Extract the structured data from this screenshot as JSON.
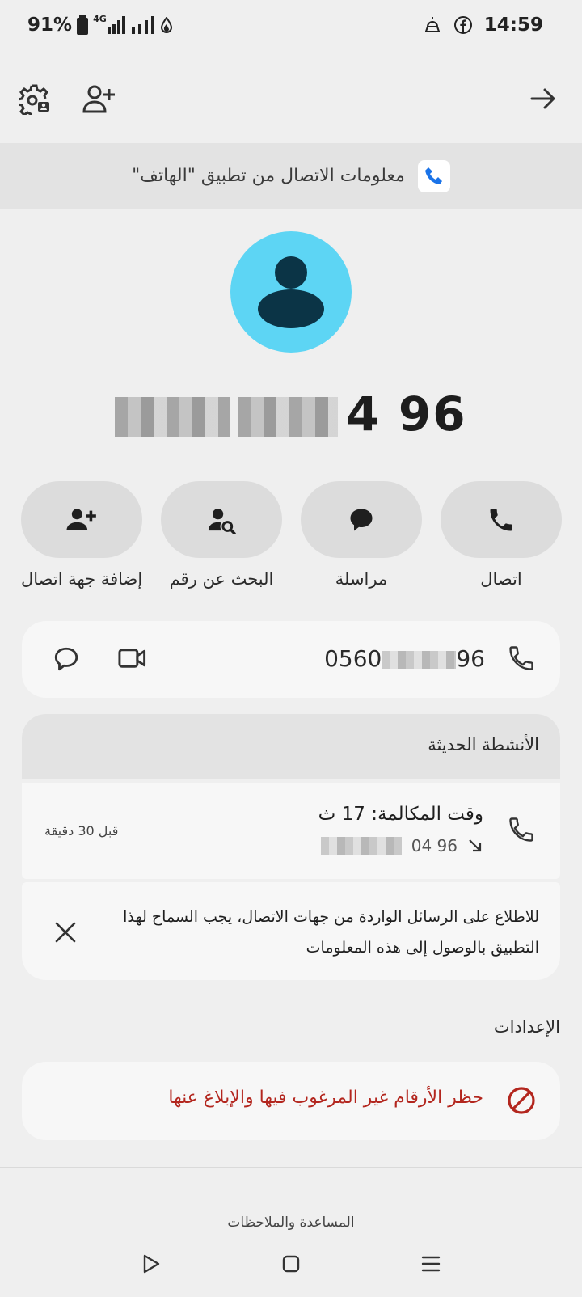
{
  "status_bar": {
    "battery": "91%",
    "network": "4G",
    "time": "14:59"
  },
  "banner": {
    "text": "معلومات الاتصال من تطبيق \"الهاتف\""
  },
  "contact": {
    "number_visible_tail": "4 96",
    "phone_prefix": "0560",
    "phone_suffix": "96"
  },
  "actions": [
    {
      "label": "اتصال",
      "icon": "phone-icon"
    },
    {
      "label": "مراسلة",
      "icon": "message-icon"
    },
    {
      "label": "البحث عن رقم",
      "icon": "person-search-icon"
    },
    {
      "label": "إضافة جهة اتصال",
      "icon": "person-add-icon"
    }
  ],
  "recent": {
    "title": "الأنشطة الحديثة",
    "call_title": "وقت المكالمة: 17 ث",
    "call_number_tail": "04 96",
    "call_time_ago": "قبل 30 دقيقة"
  },
  "notice": {
    "text_line1": "للاطلاع على الرسائل الواردة من جهات الاتصال، يجب السماح لهذا",
    "text_line2": "التطبيق بالوصول إلى هذه المعلومات"
  },
  "settings": {
    "title": "الإعدادات",
    "block_label": "حظر الأرقام غير المرغوب فيها والإبلاغ عنها"
  },
  "footer": {
    "help": "المساعدة والملاحظات"
  },
  "colors": {
    "avatar_bg": "#5dd5f4",
    "avatar_fg": "#0b3446",
    "block_red": "#b3261e",
    "pill_bg": "#dcdcdc"
  }
}
